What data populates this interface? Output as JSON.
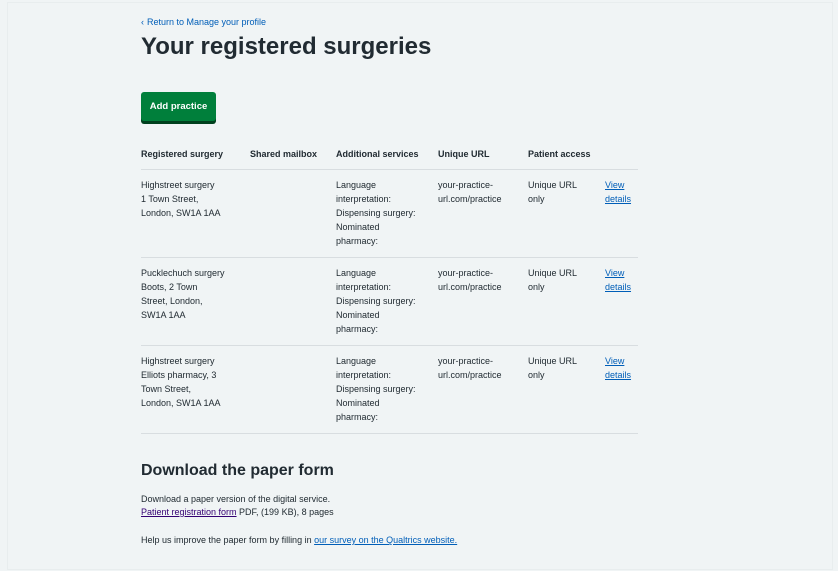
{
  "back_link": {
    "label": "Return to Manage your profile"
  },
  "page_title": "Your registered surgeries",
  "add_button": {
    "label": "Add practice"
  },
  "table": {
    "headers": [
      "Registered surgery",
      "Shared mailbox",
      "Additional services",
      "Unique URL",
      "Patient access",
      ""
    ],
    "rows": [
      {
        "surgery": "Highstreet surgery\n1 Town Street,\nLondon, SW1A 1AA",
        "mailbox": "",
        "services": "Language\ninterpretation:\nDispensing surgery:\nNominated\npharmacy:",
        "url": "your-practice-\nurl.com/practice",
        "access": "Unique URL\nonly",
        "link": "View\ndetails"
      },
      {
        "surgery": "Pucklechuch surgery\nBoots, 2 Town\nStreet, London,\nSW1A 1AA",
        "mailbox": "",
        "services": "Language\ninterpretation:\nDispensing surgery:\nNominated\npharmacy:",
        "url": "your-practice-\nurl.com/practice",
        "access": "Unique URL\nonly",
        "link": "View\ndetails"
      },
      {
        "surgery": "Highstreet surgery\nElliots pharmacy, 3\nTown Street,\nLondon, SW1A 1AA",
        "mailbox": "",
        "services": "Language\ninterpretation:\nDispensing surgery:\nNominated\npharmacy:",
        "url": "your-practice-\nurl.com/practice",
        "access": "Unique URL\nonly",
        "link": "View\ndetails"
      }
    ]
  },
  "download": {
    "heading": "Download the paper form",
    "description": "Download a paper version of the digital service.",
    "form_link": "Patient registration form",
    "form_meta": " PDF, (199 KB), 8 pages",
    "survey_text": "Help us improve the paper form by filling in ",
    "survey_link": "our survey on the Qualtrics website."
  },
  "colors": {
    "accent_link": "#005eb8",
    "button_green": "#007f3b",
    "background": "#f0f4f5"
  }
}
